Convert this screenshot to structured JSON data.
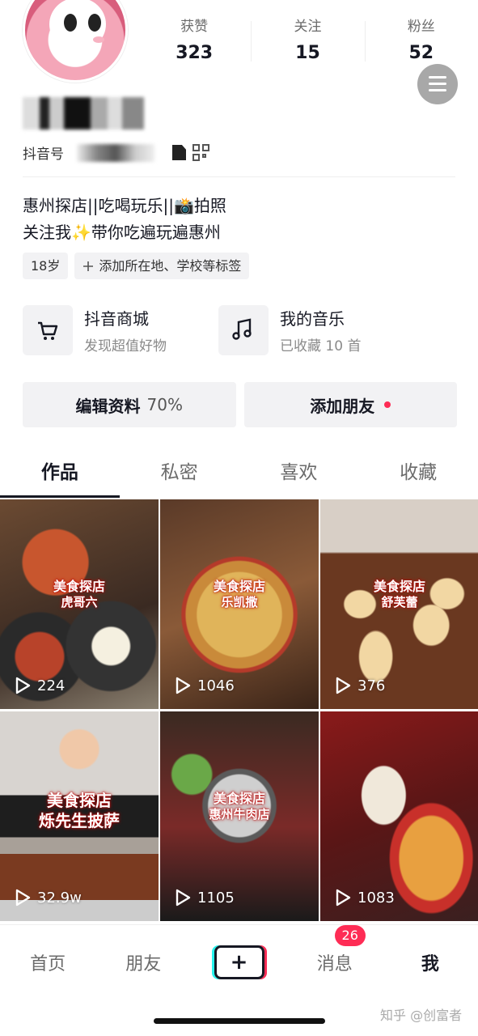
{
  "profile": {
    "stats": [
      {
        "label": "获赞",
        "value": "323"
      },
      {
        "label": "关注",
        "value": "15"
      },
      {
        "label": "粉丝",
        "value": "52"
      }
    ],
    "account_label": "抖音号",
    "bio_line1": "惠州探店||吃喝玩乐||📸拍照",
    "bio_line2": "关注我✨带你吃遍玩遍惠州",
    "tags": [
      {
        "label": "18岁"
      },
      {
        "label": "添加所在地、学校等标签"
      }
    ]
  },
  "shortcuts": [
    {
      "title": "抖音商城",
      "subtitle": "发现超值好物",
      "icon": "cart-icon"
    },
    {
      "title": "我的音乐",
      "subtitle": "已收藏 10 首",
      "icon": "music-note-icon"
    }
  ],
  "actions": {
    "edit_label": "编辑资料",
    "edit_pct": "70%",
    "add_friend_label": "添加朋友"
  },
  "tabs": [
    {
      "label": "作品",
      "active": true
    },
    {
      "label": "私密",
      "active": false
    },
    {
      "label": "喜欢",
      "active": false
    },
    {
      "label": "收藏",
      "active": false
    }
  ],
  "videos": [
    {
      "line1": "美食探店",
      "line2": "虎哥六",
      "plays": "224"
    },
    {
      "line1": "美食探店",
      "line2": "乐凯撒",
      "plays": "1046"
    },
    {
      "line1": "美食探店",
      "line2": "舒芙蕾",
      "plays": "376"
    },
    {
      "line1": "美食探店",
      "line2": "烁先生披萨",
      "plays": "32.9w"
    },
    {
      "line1": "美食探店",
      "line2": "惠州牛肉店",
      "plays": "1105"
    },
    {
      "line1": "",
      "line2": "",
      "plays": "1083"
    }
  ],
  "bottom_nav": {
    "home": "首页",
    "friends": "朋友",
    "plus": "+",
    "messages": "消息",
    "messages_badge": "26",
    "me": "我"
  },
  "watermark": "知乎 @创富者",
  "colors": {
    "accent": "#fe2c55",
    "cyan": "#25f4ee",
    "text": "#161823"
  }
}
